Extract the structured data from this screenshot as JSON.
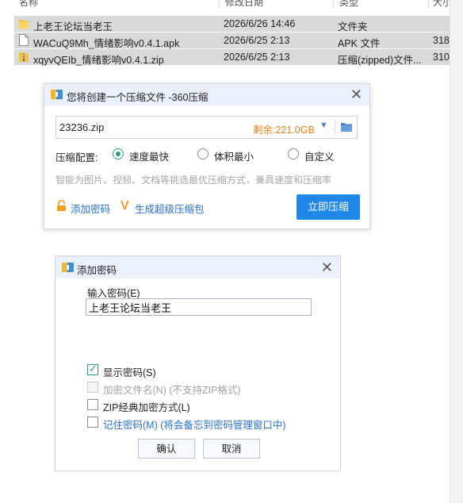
{
  "explorer": {
    "columns": [
      "名称",
      "修改日期",
      "类型",
      "大小"
    ],
    "files": [
      {
        "name": "上老王论坛当老王",
        "date": "2026/6/26 14:46",
        "type": "文件夹",
        "size": "",
        "icon": "folder-icon"
      },
      {
        "name": "WACuQ9Mh_情绪影响v0.4.1.apk",
        "date": "2026/6/25 2:13",
        "type": "APK 文件",
        "size": "318",
        "icon": "apk-file-icon"
      },
      {
        "name": "xqyvQEIb_情绪影响v0.4.1.zip",
        "date": "2026/6/25 2:13",
        "type": "压缩(zipped)文件...",
        "size": "310",
        "icon": "zip-file-icon"
      }
    ]
  },
  "compress_dialog": {
    "title": "您将创建一个压缩文件 -360压缩",
    "filename": "23236.zip",
    "remaining": "剩余:221.0GB",
    "config_label": "压缩配置:",
    "options": [
      "速度最快",
      "体积最小",
      "自定义"
    ],
    "selected_option": "速度最快",
    "hint": "智能为图片、视频、文档等挑选最优压缩方式，兼具速度和压缩率",
    "add_password_link": "添加密码",
    "sfx_link": "生成超级压缩包",
    "compress_button": "立即压缩",
    "accent_color": "#1e87e8"
  },
  "password_dialog": {
    "title": "添加密码",
    "input_label": "输入密码(E)",
    "password_value": "上老王论坛当老王",
    "show_password": "显示密码(S)",
    "encrypt_filenames": "加密文件名(N) (不支持ZIP格式)",
    "zip_classic": "ZIP经典加密方式(L)",
    "remember_password": "记住密码(M) (将会备忘到密码管理窗口中)",
    "ok_button": "确认",
    "cancel_button": "取消",
    "checked": {
      "show_password": true,
      "encrypt_filenames": false,
      "zip_classic": false,
      "remember_password": false
    }
  }
}
